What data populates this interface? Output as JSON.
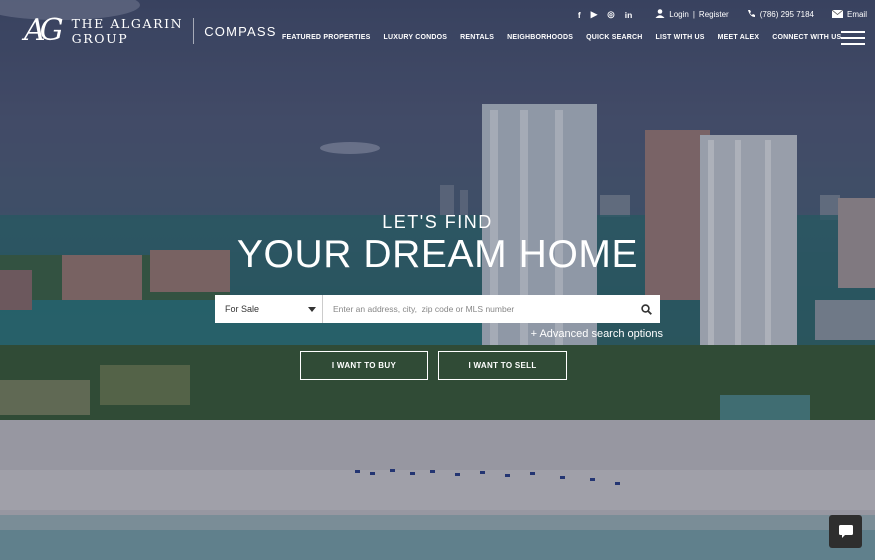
{
  "brand": {
    "monogram": "AG",
    "name_line1": "THE ALGARIN",
    "name_line2": "GROUP",
    "partner": "COMPASS"
  },
  "utility": {
    "social": [
      "f",
      "▶",
      "◎",
      "in"
    ],
    "login": "Login",
    "separator": "|",
    "register": "Register",
    "phone": "(786) 295 7184",
    "email": "Email"
  },
  "nav": [
    "FEATURED PROPERTIES",
    "LUXURY CONDOS",
    "RENTALS",
    "NEIGHBORHOODS",
    "QUICK SEARCH",
    "LIST WITH US",
    "MEET ALEX",
    "CONNECT WITH US"
  ],
  "hero": {
    "kicker": "LET'S FIND",
    "headline": "YOUR DREAM HOME"
  },
  "search": {
    "type_value": "For Sale",
    "placeholder": "Enter an address, city,  zip code or MLS number",
    "advanced": "+ Advanced search options"
  },
  "ctas": {
    "buy": "I WANT TO BUY",
    "sell": "I WANT TO SELL"
  },
  "icons": {
    "search": "magnifier-icon",
    "chat": "chat-bubble-icon",
    "menu": "hamburger-icon"
  }
}
